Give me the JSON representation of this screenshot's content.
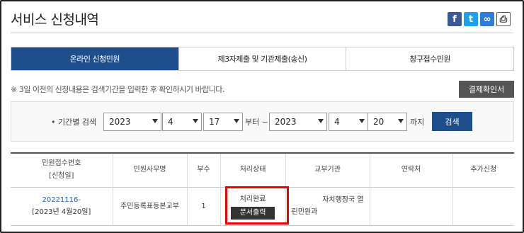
{
  "page": {
    "title": "서비스 신청내역"
  },
  "share": {
    "icons": [
      "facebook-icon",
      "twitter-icon",
      "link-icon",
      "print-icon"
    ]
  },
  "tabs": [
    {
      "label": "온라인 신청민원",
      "active": true
    },
    {
      "label": "제3자제출 및 기관제출(송신)",
      "active": false
    },
    {
      "label": "창구접수민원",
      "active": false
    }
  ],
  "notice": "※ 3일 이전의 신청내용은 검색기간을 입력한 후 확인하시기 바랍니다.",
  "payment_button": "결제확인서",
  "search": {
    "label": "• 기간별 검색",
    "from_year": "2023",
    "from_month": "4",
    "from_day": "17",
    "to_sep": "부터 ~",
    "to_year": "2023",
    "to_month": "4",
    "to_day": "20",
    "until": "까지",
    "button": "검색"
  },
  "table": {
    "headers": [
      "민원접수번호",
      "[신청일]",
      "민원사무명",
      "부수",
      "처리상태",
      "교부기관",
      "연락처",
      "추가신청"
    ],
    "row": {
      "receipt_no": "20221116-",
      "date": "[2023년 4월20일]",
      "service": "주민등록표등본교부",
      "copies": "1",
      "status": "처리완료",
      "print_button": "문서출력",
      "agency_line1": "자치행정국 열",
      "agency_line2": "린민원과",
      "contact": "",
      "extra": ""
    }
  },
  "colors": {
    "accent": "#1f4e8c",
    "highlight": "#e00000"
  }
}
